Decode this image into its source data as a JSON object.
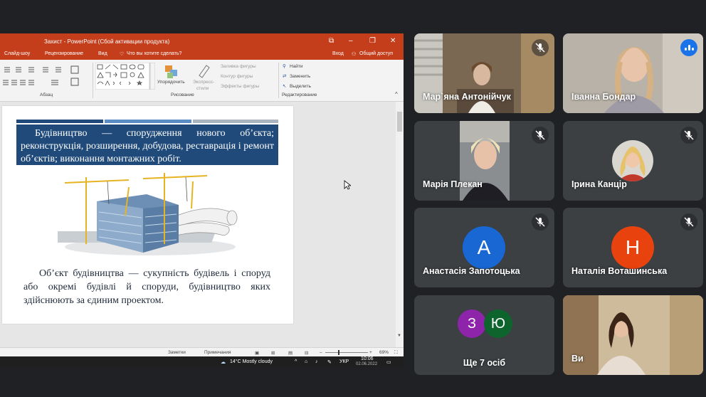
{
  "ppt": {
    "window_title": "Захист - PowerPoint (Сбой активации продукта)",
    "menu": {
      "slideshow": "Слайд-шоу",
      "review": "Рецензирование",
      "view": "Вид",
      "tell_me": "Что вы хотите сделать?",
      "signin": "Вход",
      "share": "Общий доступ"
    },
    "ribbon": {
      "paragraph_group": "Абзац",
      "drawing_group": "Рисование",
      "editing_group": "Редактирование",
      "arrange": "Упорядочить",
      "quick_styles_1": "Экспресс-",
      "quick_styles_2": "стили",
      "shape_fill": "Заливка фигуры",
      "shape_outline": "Контур фигуры",
      "shape_effects": "Эффекты фигуры",
      "find": "Найти",
      "replace": "Заменить",
      "select": "Выделить"
    },
    "slide": {
      "heading_text": "Будівництво — спорудження нового об’єкта; реконструкція, розширення, добудова, реставрація і ремонт об’єктів; виконання монтажних робіт.",
      "body_text": "Об’єкт будівництва — сукупність будівель і споруд або окремі будівлі й споруди, будівництво яких здійснюють за єдиним проектом."
    },
    "status": {
      "notes": "Заметки",
      "comments": "Примечания",
      "zoom": "69%"
    },
    "taskbar": {
      "weather": "14°C  Mostly cloudy",
      "lang": "УКР",
      "time": "10:06",
      "date": "02.06.2022"
    }
  },
  "participants": [
    {
      "name": "Мар`яна Антонійчук",
      "muted": true
    },
    {
      "name": "Іванна Бондар",
      "muted": false,
      "speaking": true
    },
    {
      "name": "Марія Плекан",
      "muted": true
    },
    {
      "name": "Ірина Канцір",
      "muted": true
    },
    {
      "name": "Анастасія Запотоцька",
      "muted": true,
      "initial": "А",
      "color": "#1967d2"
    },
    {
      "name": "Наталія Воташинська",
      "muted": true,
      "initial": "Н",
      "color": "#e8430f"
    },
    {
      "name": "Ще 7 осіб",
      "initials": [
        "З",
        "Ю"
      ],
      "colors": [
        "#8e24aa",
        "#0d652d"
      ]
    },
    {
      "name": "Ви"
    }
  ],
  "colors": {
    "ppt_accent": "#c43e1c",
    "tile_bg": "#3c4043",
    "speaking": "#1a73e8",
    "slide_box": "#1f4a7a"
  }
}
